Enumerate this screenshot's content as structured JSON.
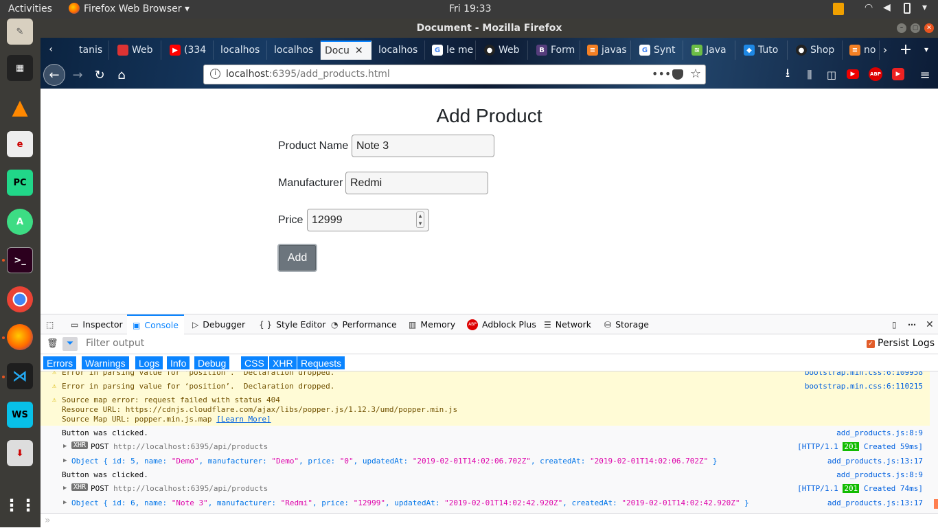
{
  "topbar": {
    "activities": "Activities",
    "app_menu": "Firefox Web Browser ▾",
    "clock": "Fri 19:33"
  },
  "window": {
    "title": "Document - Mozilla Firefox"
  },
  "tabs": [
    {
      "label": "tanis",
      "favicon": "bookmark-icon"
    },
    {
      "label": "Web",
      "favicon": "red-page-icon"
    },
    {
      "label": "(334",
      "favicon": "youtube-icon"
    },
    {
      "label": "localhos",
      "favicon": "blank"
    },
    {
      "label": "localhos",
      "favicon": "blank"
    },
    {
      "label": "Docu",
      "favicon": "blank",
      "active": true
    },
    {
      "label": "localhos",
      "favicon": "blank"
    },
    {
      "label": "le me",
      "favicon": "google-icon"
    },
    {
      "label": "Web",
      "favicon": "github-icon"
    },
    {
      "label": "Form",
      "favicon": "bootstrap-icon"
    },
    {
      "label": "javas",
      "favicon": "stackoverflow-icon"
    },
    {
      "label": "Synt",
      "favicon": "google-icon"
    },
    {
      "label": "Java",
      "favicon": "java-icon"
    },
    {
      "label": "Tuto",
      "favicon": "cube-icon"
    },
    {
      "label": "Shop",
      "favicon": "github-icon"
    },
    {
      "label": "no",
      "favicon": "stackoverflow-icon"
    }
  ],
  "url": {
    "host": "localhost",
    "rest": ":6395/add_products.html"
  },
  "page": {
    "heading": "Add Product",
    "fields": {
      "name_label": "Product Name",
      "name_value": "Note 3",
      "manufacturer_label": "Manufacturer",
      "manufacturer_value": "Redmi",
      "price_label": "Price",
      "price_value": "12999"
    },
    "add_button": "Add"
  },
  "devtools": {
    "tabs": [
      "Inspector",
      "Console",
      "Debugger",
      "Style Editor",
      "Performance",
      "Memory",
      "Adblock Plus",
      "Network",
      "Storage"
    ],
    "filter_placeholder": "Filter output",
    "persist_logs": "Persist Logs",
    "filters": [
      "Errors",
      "Warnings",
      "Logs",
      "Info",
      "Debug",
      "CSS",
      "XHR",
      "Requests"
    ],
    "log": {
      "w1_text": "Error in parsing value for ‘position’.  Declaration dropped.",
      "w1_src": "bootstrap.min.css:6:109958",
      "w2_text": "Error in parsing value for ‘position’.  Declaration dropped.",
      "w2_src": "bootstrap.min.css:6:110215",
      "w3_l1": "Source map error: request failed with status 404",
      "w3_l2": "Resource URL: https://cdnjs.cloudflare.com/ajax/libs/popper.js/1.12.3/umd/popper.min.js",
      "w3_l3": "Source Map URL: popper.min.js.map ",
      "w3_link": "[Learn More]",
      "l1": "Button was clicked.",
      "l1_src": "add_products.js:8:9",
      "x1_method": "POST",
      "x1_url": "http://localhost:6395/api/products",
      "x1_proto": "[HTTP/1.1 ",
      "x1_status": "201",
      "x1_tail": " Created 59ms]",
      "o1_src": "add_products.js:13:17",
      "o1_pre": "Object { id: ",
      "o1_id": "5",
      "o1_name": "\"Demo\"",
      "o1_manu": "\"Demo\"",
      "o1_price": "\"0\"",
      "o1_upd": "\"2019-02-01T14:02:06.702Z\"",
      "o1_cre": "\"2019-02-01T14:02:06.702Z\"",
      "l2": "Button was clicked.",
      "l2_src": "add_products.js:8:9",
      "x2_method": "POST",
      "x2_url": "http://localhost:6395/api/products",
      "x2_proto": "[HTTP/1.1 ",
      "x2_status": "201",
      "x2_tail": " Created 74ms]",
      "o2_src": "add_products.js:13:17",
      "o2_pre": "Object { id: ",
      "o2_id": "6",
      "o2_name": "\"Note 3\"",
      "o2_manu": "\"Redmi\"",
      "o2_price": "\"12999\"",
      "o2_upd": "\"2019-02-01T14:02:42.920Z\"",
      "o2_cre": "\"2019-02-01T14:02:42.920Z\""
    }
  }
}
